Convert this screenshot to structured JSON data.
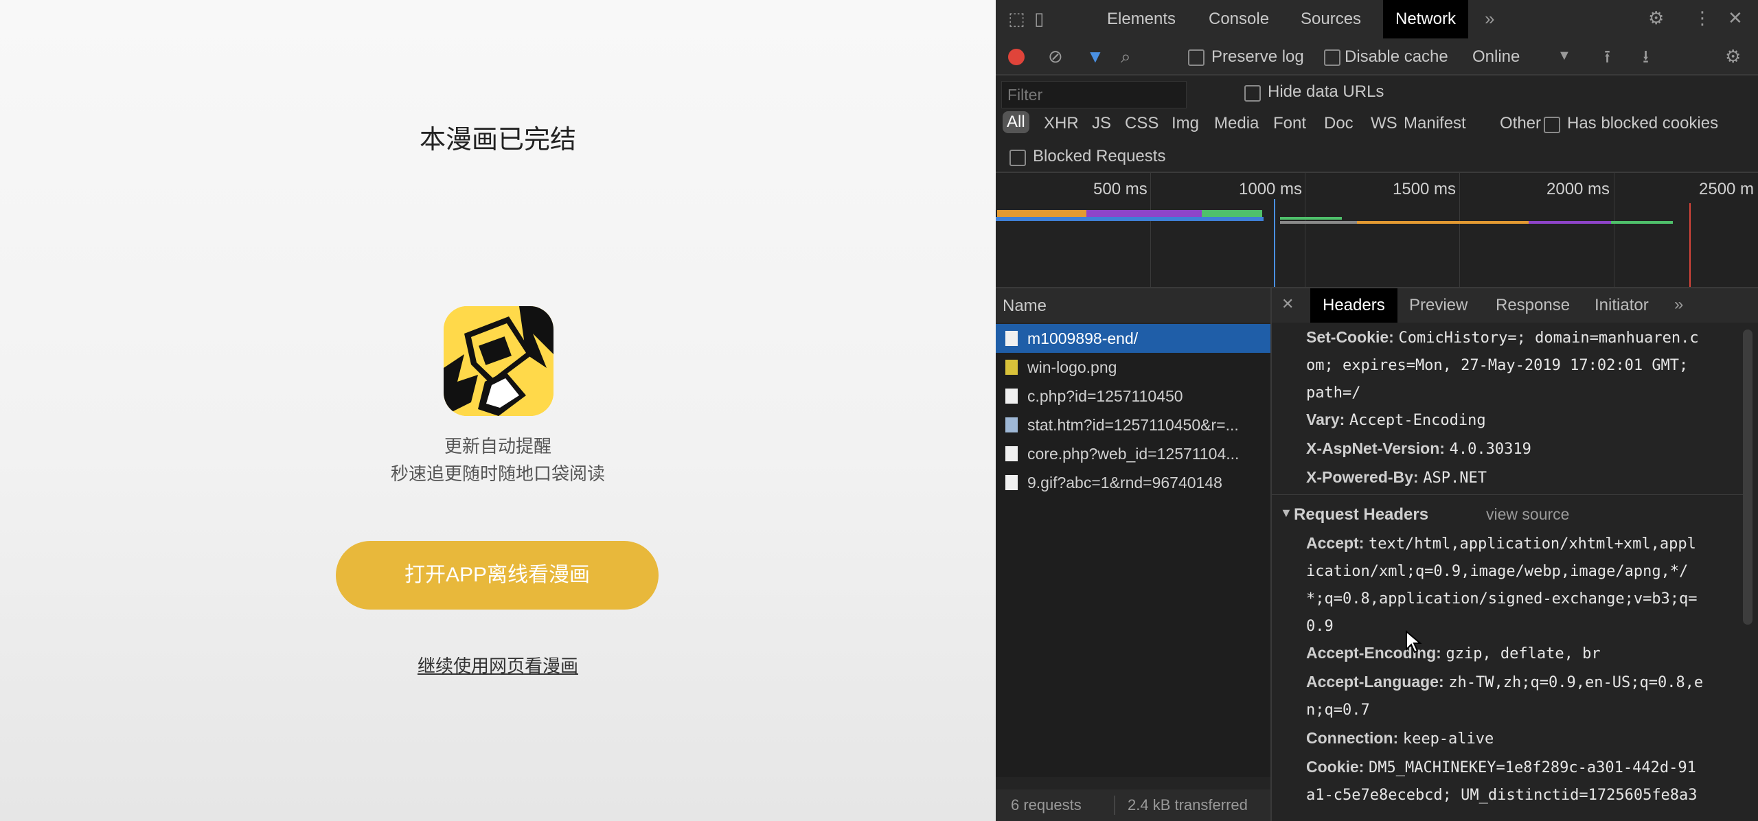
{
  "page": {
    "title": "本漫画已完结",
    "promo_line1": "更新自动提醒",
    "promo_line2": "秒速追更随时随地口袋阅读",
    "open_app_button": "打开APP离线看漫画",
    "continue_web_link": "继续使用网页看漫画"
  },
  "devtools": {
    "tabs": [
      "Elements",
      "Console",
      "Sources",
      "Network"
    ],
    "active_tab": "Network",
    "toolbar": {
      "preserve_log": "Preserve log",
      "disable_cache": "Disable cache",
      "throttling": "Online"
    },
    "filter": {
      "placeholder": "Filter",
      "hide_data_urls": "Hide data URLs",
      "types": [
        "All",
        "XHR",
        "JS",
        "CSS",
        "Img",
        "Media",
        "Font",
        "Doc",
        "WS",
        "Manifest",
        "Other"
      ],
      "has_blocked_cookies": "Has blocked cookies",
      "blocked_requests": "Blocked Requests"
    },
    "timeline": {
      "ticks": [
        "500 ms",
        "1000 ms",
        "1500 ms",
        "2000 ms",
        "2500 m"
      ]
    },
    "requests": {
      "column_name": "Name",
      "items": [
        "m1009898-end/",
        "win-logo.png",
        "c.php?id=1257110450",
        "stat.htm?id=1257110450&r=...",
        "core.php?web_id=12571104...",
        "9.gif?abc=1&rnd=96740148"
      ],
      "summary_requests": "6 requests",
      "summary_transferred": "2.4 kB transferred"
    },
    "detail_tabs": [
      "Headers",
      "Preview",
      "Response",
      "Initiator"
    ],
    "response_headers_tail": [
      {
        "key": "Set-Cookie:",
        "value": "ComicHistory=; domain=manhuaren.c"
      },
      {
        "key": "",
        "value": "om; expires=Mon, 27-May-2019 17:02:01 GMT;"
      },
      {
        "key": "",
        "value": "path=/"
      },
      {
        "key": "Vary:",
        "value": "Accept-Encoding"
      },
      {
        "key": "X-AspNet-Version:",
        "value": "4.0.30319"
      },
      {
        "key": "X-Powered-By:",
        "value": "ASP.NET"
      }
    ],
    "request_headers_title": "Request Headers",
    "view_source": "view source",
    "request_headers": [
      {
        "key": "Accept:",
        "value": "text/html,application/xhtml+xml,appl"
      },
      {
        "key": "",
        "value": "ication/xml;q=0.9,image/webp,image/apng,*/"
      },
      {
        "key": "",
        "value": "*;q=0.8,application/signed-exchange;v=b3;q="
      },
      {
        "key": "",
        "value": "0.9"
      },
      {
        "key": "Accept-Encoding:",
        "value": "gzip, deflate, br"
      },
      {
        "key": "Accept-Language:",
        "value": "zh-TW,zh;q=0.9,en-US;q=0.8,e"
      },
      {
        "key": "",
        "value": "n;q=0.7"
      },
      {
        "key": "Connection:",
        "value": "keep-alive"
      },
      {
        "key": "Cookie:",
        "value": "DM5_MACHINEKEY=1e8f289c-a301-442d-91"
      },
      {
        "key": "",
        "value": "a1-c5e7e8ecebcd; UM_distinctid=1725605fe8a3"
      }
    ],
    "colors": {
      "selected_row": "#1f5ea8",
      "record_red": "#e0443a",
      "open_app_button": "#e8b83b"
    }
  }
}
